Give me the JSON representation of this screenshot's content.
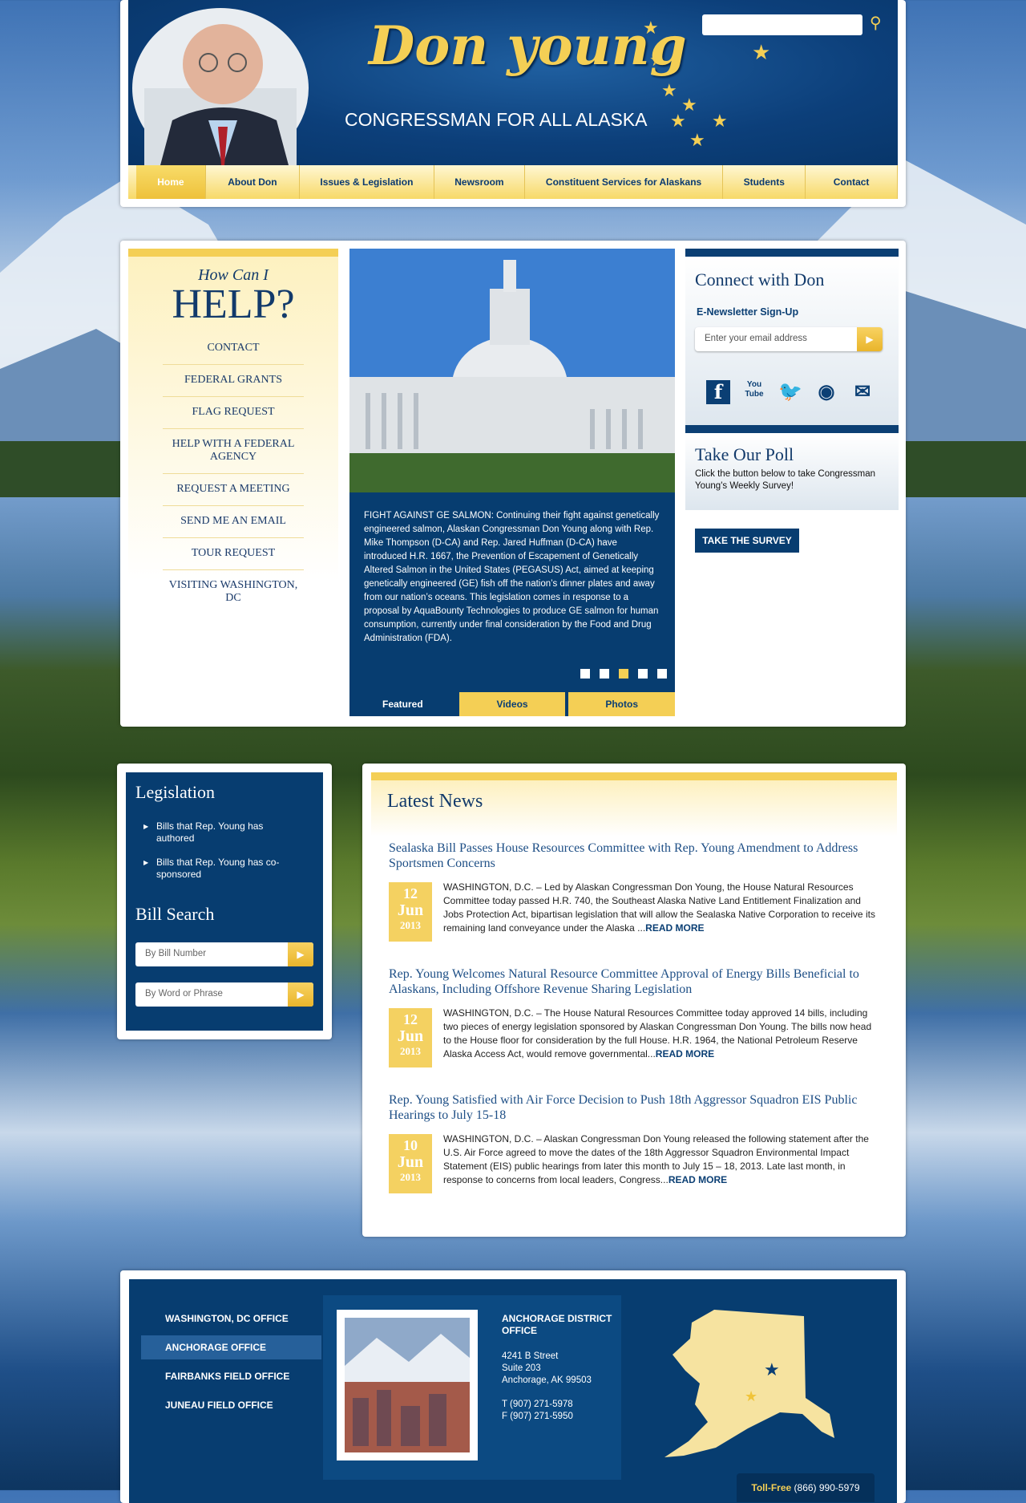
{
  "header": {
    "logo_name": "Don young",
    "logo_subtitle": "CONGRESSMAN FOR ALL ALASKA",
    "search_placeholder": "",
    "nav": [
      {
        "label": "Home",
        "active": true,
        "w": 88
      },
      {
        "label": "About Don",
        "w": 118
      },
      {
        "label": "Issues & Legislation",
        "w": 170
      },
      {
        "label": "Newsroom",
        "w": 114
      },
      {
        "label": "Constituent Services for Alaskans",
        "w": 250
      },
      {
        "label": "Students",
        "w": 104
      },
      {
        "label": "Contact",
        "w": 116
      }
    ]
  },
  "help": {
    "title_small": "How Can I",
    "title_big": "HELP?",
    "items": [
      "CONTACT",
      "FEDERAL GRANTS",
      "FLAG REQUEST",
      "HELP WITH A FEDERAL AGENCY",
      "REQUEST A MEETING",
      "SEND ME AN EMAIL",
      "TOUR REQUEST",
      "VISITING WASHINGTON, DC"
    ]
  },
  "slider": {
    "caption": "FIGHT AGAINST GE SALMON: Continuing their fight against genetically engineered salmon, Alaskan Congressman Don Young along with Rep. Mike Thompson (D-CA) and Rep. Jared Huffman (D-CA) have introduced H.R. 1667, the Prevention of Escapement of Genetically Altered Salmon in the United States (PEGASUS) Act, aimed at keeping genetically engineered (GE) fish off the nation’s dinner plates and away from our nation’s oceans. This legislation comes in response to a proposal by AquaBounty Technologies to produce GE salmon for human consumption, currently under final consideration by the Food and Drug Administration (FDA).",
    "active_dot": 2,
    "tabs": [
      "Featured",
      "Videos",
      "Photos"
    ]
  },
  "connect": {
    "title": "Connect with Don",
    "newsletter_label": "E-Newsletter Sign-Up",
    "email_placeholder": "Enter your email address",
    "social": [
      "facebook-icon",
      "youtube-icon",
      "twitter-icon",
      "rss-icon",
      "email-icon"
    ],
    "youtube_text": "You Tube",
    "poll_title": "Take Our Poll",
    "poll_text": "Click the button below to take Congressman Young's Weekly Survey!",
    "survey_button": "TAKE THE SURVEY"
  },
  "legislation": {
    "title": "Legislation",
    "items": [
      "Bills that Rep. Young has authored",
      "Bills that Rep. Young has co-sponsored"
    ],
    "bill_search_title": "Bill Search",
    "by_number": "By Bill Number",
    "by_word": "By Word or Phrase"
  },
  "news": {
    "title": "Latest News",
    "items": [
      {
        "title": "Sealaska Bill Passes House Resources Committee with Rep. Young Amendment to Address Sportsmen Concerns",
        "day": "12",
        "month": "Jun",
        "year": "2013",
        "body": "WASHINGTON, D.C. – Led by Alaskan Congressman Don Young, the House Natural Resources Committee today passed H.R. 740, the Southeast Alaska Native Land Entitlement Finalization and Jobs Protection Act, bipartisan legislation that will allow the Sealaska Native Corporation to receive its remaining land conveyance under the Alaska ...",
        "more": "READ MORE"
      },
      {
        "title": "Rep. Young Welcomes Natural Resource Committee Approval of Energy Bills Beneficial to Alaskans, Including Offshore Revenue Sharing Legislation",
        "day": "12",
        "month": "Jun",
        "year": "2013",
        "body": "WASHINGTON, D.C. – The House Natural Resources Committee today approved 14 bills, including two pieces of energy legislation sponsored by Alaskan Congressman Don Young. The bills now head to the House floor for consideration by the full House. H.R. 1964, the National Petroleum Reserve Alaska Access Act, would remove governmental...",
        "more": "READ MORE"
      },
      {
        "title": "Rep. Young Satisfied with Air Force Decision to Push 18th Aggressor Squadron EIS Public Hearings to July 15-18",
        "day": "10",
        "month": "Jun",
        "year": "2013",
        "body": "WASHINGTON, D.C. – Alaskan Congressman Don Young released the following statement after the U.S. Air Force agreed to move the dates of the 18th Aggressor Squadron Environmental Impact Statement (EIS) public hearings from later this month to July 15 – 18, 2013. Late last month, in response to concerns from local leaders, Congress...",
        "more": "READ MORE"
      }
    ]
  },
  "footer": {
    "offices": [
      "WASHINGTON, DC OFFICE",
      "ANCHORAGE OFFICE",
      "FAIRBANKS FIELD OFFICE",
      "JUNEAU FIELD OFFICE"
    ],
    "active_office": 1,
    "office_title": "ANCHORAGE DISTRICT OFFICE",
    "address": [
      "4241 B Street",
      "Suite 203",
      "Anchorage, AK 99503"
    ],
    "phone": "T (907) 271-5978",
    "fax": "F (907) 271-5950",
    "toll_free_label": "Toll-Free",
    "toll_free_number": "(866) 990-5979"
  },
  "colors": {
    "navy": "#073d70",
    "gold": "#f4cf55"
  }
}
